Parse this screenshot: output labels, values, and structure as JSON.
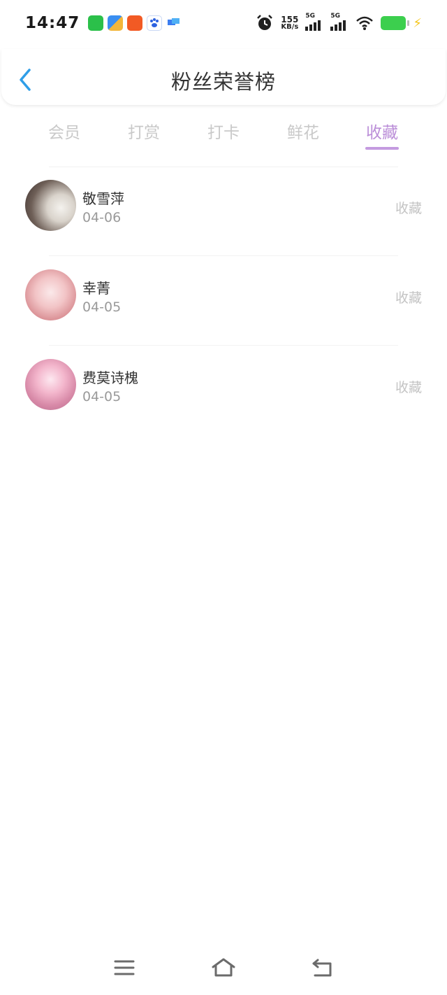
{
  "status_bar": {
    "time": "14:47",
    "net_speed_value": "155",
    "net_speed_unit": "KB/s",
    "sig1_label": "5G",
    "sig2_label": "5G",
    "app_icons": [
      "wechat-icon",
      "files-icon",
      "kuaishou-icon",
      "baidu-icon",
      "message-icon"
    ],
    "battery_color": "#3ccf4e"
  },
  "header": {
    "title": "粉丝荣誉榜",
    "back_icon": "chevron-left-icon",
    "accent": "#2f9ee8"
  },
  "tabs": [
    {
      "label": "会员",
      "active": false
    },
    {
      "label": "打赏",
      "active": false
    },
    {
      "label": "打卡",
      "active": false
    },
    {
      "label": "鲜花",
      "active": false
    },
    {
      "label": "收藏",
      "active": true
    }
  ],
  "tab_active_color": "#bb8ed8",
  "fans": [
    {
      "name": "敬雪萍",
      "date": "04-06",
      "action": "收藏"
    },
    {
      "name": "幸菁",
      "date": "04-05",
      "action": "收藏"
    },
    {
      "name": "费莫诗槐",
      "date": "04-05",
      "action": "收藏"
    }
  ],
  "nav": [
    "menu-icon",
    "home-icon",
    "back-icon"
  ]
}
